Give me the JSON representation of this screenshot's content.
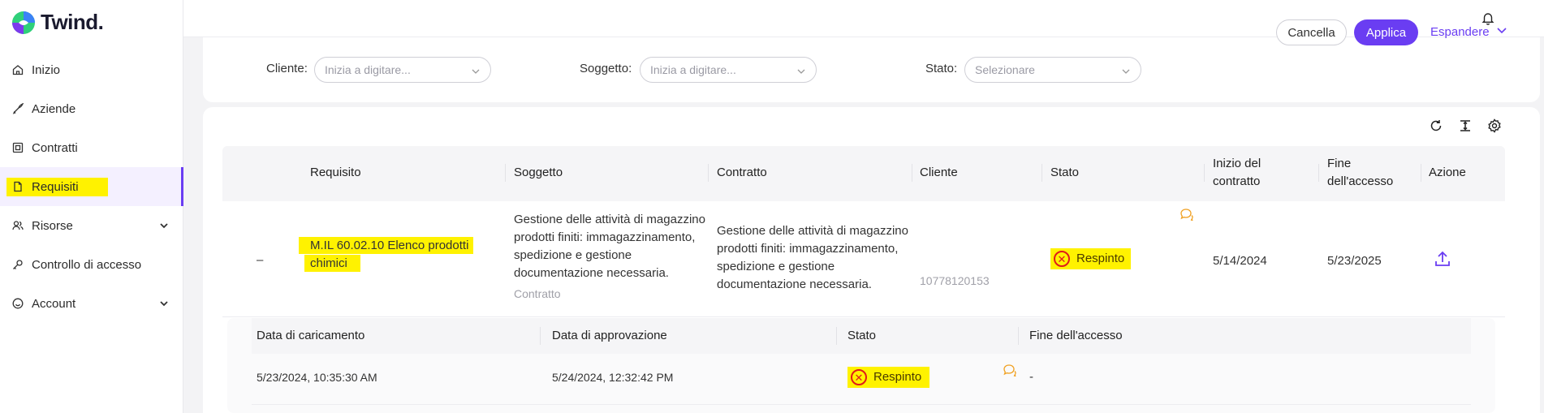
{
  "brand": {
    "name": "Twind."
  },
  "sidebar": {
    "items": [
      {
        "label": "Inizio",
        "icon": "home-icon"
      },
      {
        "label": "Aziende",
        "icon": "rocket-icon"
      },
      {
        "label": "Contratti",
        "icon": "contract-icon"
      },
      {
        "label": "Requisiti",
        "icon": "document-icon",
        "active": true
      },
      {
        "label": "Risorse",
        "icon": "users-icon",
        "expandable": true
      },
      {
        "label": "Controllo di accesso",
        "icon": "key-icon"
      },
      {
        "label": "Account",
        "icon": "smile-icon",
        "expandable": true
      }
    ]
  },
  "filters": {
    "cliente_label": "Cliente",
    "cliente_placeholder": "Inizia a digitare...",
    "soggetto_label": "Soggetto",
    "soggetto_placeholder": "Inizia a digitare...",
    "stato_label": "Stato",
    "stato_placeholder": "Selezionare",
    "cancel_label": "Cancella",
    "apply_label": "Applica",
    "expand_label": "Espandere"
  },
  "table": {
    "columns": {
      "requisito": "Requisito",
      "soggetto": "Soggetto",
      "contratto": "Contratto",
      "cliente": "Cliente",
      "stato": "Stato",
      "inizio_1": "Inizio del",
      "inizio_2": "contratto",
      "fine_1": "Fine",
      "fine_2": "dell'accesso",
      "azione": "Azione"
    },
    "row": {
      "collapse": "–",
      "requisito_1": "M.IL 60.02.10 Elenco prodotti",
      "requisito_2": "chimici",
      "soggetto_1": "Gestione delle attività di magazzino",
      "soggetto_2": "prodotti finiti: immagazzinamento,",
      "soggetto_3": "spedizione e gestione",
      "soggetto_4": "documentazione necessaria.",
      "soggetto_type": "Contratto",
      "contratto_1": "Gestione delle attività di magazzino",
      "contratto_2": "prodotti finiti: immagazzinamento,",
      "contratto_3": "spedizione e gestione",
      "contratto_4": "documentazione necessaria.",
      "cliente": "10778120153",
      "stato": "Respinto",
      "inizio": "5/14/2024",
      "fine": "5/23/2025"
    }
  },
  "subtable": {
    "columns": {
      "caricamento": "Data di caricamento",
      "approvazione": "Data di approvazione",
      "stato": "Stato",
      "fine": "Fine dell'accesso"
    },
    "row": {
      "caricamento": "5/23/2024, 10:35:30 AM",
      "approvazione": "5/24/2024, 12:32:42 PM",
      "stato": "Respinto",
      "fine": "-"
    }
  },
  "colors": {
    "accent": "#6a3df2",
    "highlight": "#fff200",
    "reject": "#e01b1b",
    "comment": "#f0a020"
  }
}
